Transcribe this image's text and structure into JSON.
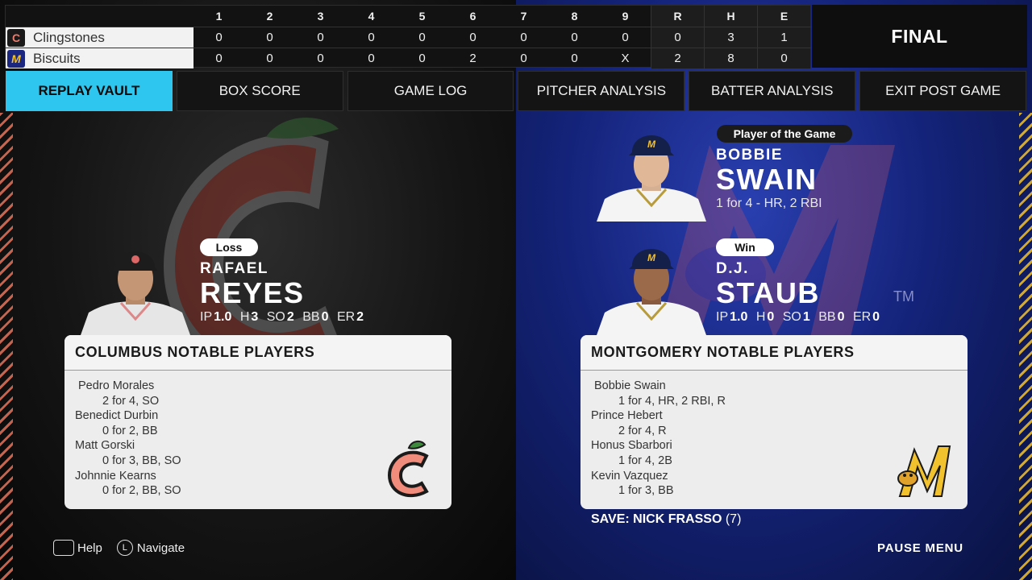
{
  "scoreboard": {
    "innings": [
      "1",
      "2",
      "3",
      "4",
      "5",
      "6",
      "7",
      "8",
      "9"
    ],
    "totals_headers": [
      "R",
      "H",
      "E"
    ],
    "status": "FINAL",
    "teams": [
      {
        "name": "Clingstones",
        "logo": "c-peach-icon",
        "innings": [
          "0",
          "0",
          "0",
          "0",
          "0",
          "0",
          "0",
          "0",
          "0"
        ],
        "totals": [
          "0",
          "3",
          "1"
        ]
      },
      {
        "name": "Biscuits",
        "logo": "m-biscuit-icon",
        "innings": [
          "0",
          "0",
          "0",
          "0",
          "0",
          "2",
          "0",
          "0",
          "X"
        ],
        "totals": [
          "2",
          "8",
          "0"
        ]
      }
    ]
  },
  "tabs": [
    {
      "label": "REPLAY VAULT",
      "active": true
    },
    {
      "label": "BOX SCORE",
      "active": false
    },
    {
      "label": "GAME LOG",
      "active": false
    },
    {
      "label": "PITCHER ANALYSIS",
      "active": false
    },
    {
      "label": "BATTER ANALYSIS",
      "active": false
    },
    {
      "label": "EXIT POST GAME",
      "active": false
    }
  ],
  "loser": {
    "badge": "Loss",
    "first": "RAFAEL",
    "last": "REYES",
    "stats": [
      {
        "label": "IP",
        "value": "1.0"
      },
      {
        "label": "H",
        "value": "3"
      },
      {
        "label": "SO",
        "value": "2"
      },
      {
        "label": "BB",
        "value": "0"
      },
      {
        "label": "ER",
        "value": "2"
      }
    ]
  },
  "potg": {
    "badge": "Player of the Game",
    "first": "BOBBIE",
    "last": "SWAIN",
    "line": "1 for 4  - HR, 2 RBI"
  },
  "winner": {
    "badge": "Win",
    "first": "D.J.",
    "last": "STAUB",
    "trademark": "TM",
    "stats": [
      {
        "label": "IP",
        "value": "1.0"
      },
      {
        "label": "H",
        "value": "0"
      },
      {
        "label": "SO",
        "value": "1"
      },
      {
        "label": "BB",
        "value": "0"
      },
      {
        "label": "ER",
        "value": "0"
      }
    ]
  },
  "columbus": {
    "title": "COLUMBUS NOTABLE PLAYERS",
    "players": [
      {
        "name": "Pedro Morales",
        "line": "2 for 4, SO"
      },
      {
        "name": "Benedict Durbin",
        "line": "0 for 2, BB"
      },
      {
        "name": "Matt Gorski",
        "line": "0 for 3, BB, SO"
      },
      {
        "name": "Johnnie Kearns",
        "line": "0 for 2, BB, SO"
      }
    ]
  },
  "montgomery": {
    "title": "MONTGOMERY NOTABLE PLAYERS",
    "players": [
      {
        "name": "Bobbie Swain",
        "line": "1 for 4, HR, 2 RBI, R"
      },
      {
        "name": "Prince Hebert",
        "line": "2 for 4, R"
      },
      {
        "name": "Honus Sbarbori",
        "line": "1 for 4, 2B"
      },
      {
        "name": "Kevin Vazquez",
        "line": "1 for 3, BB"
      }
    ],
    "save_label": "SAVE: NICK FRASSO",
    "save_count": "(7)"
  },
  "footer": {
    "help": "Help",
    "navigate_key": "L",
    "navigate": "Navigate",
    "pause": "PAUSE MENU"
  },
  "colors": {
    "accent": "#2ec6ef",
    "columbus": "#f27a6a",
    "montgomery": "#f2c12e",
    "montgomery_bg": "#14237a"
  }
}
